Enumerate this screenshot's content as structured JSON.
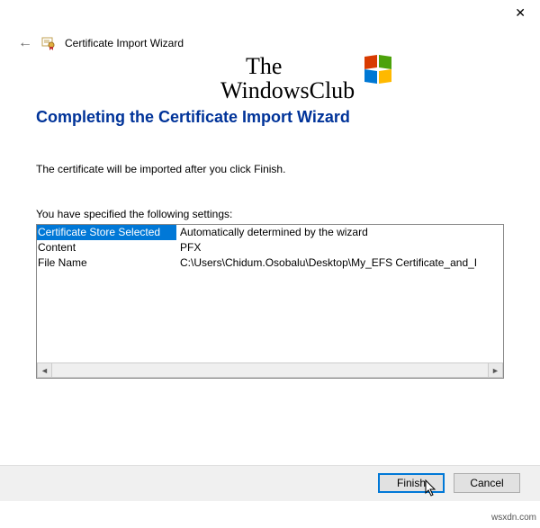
{
  "window": {
    "wizard_title": "Certificate Import Wizard"
  },
  "watermark": {
    "line1": "The",
    "line2": "WindowsClub"
  },
  "main": {
    "heading": "Completing the Certificate Import Wizard",
    "instruction": "The certificate will be imported after you click Finish.",
    "settings_label": "You have specified the following settings:",
    "rows": [
      {
        "label": "Certificate Store Selected",
        "value": "Automatically determined by the wizard"
      },
      {
        "label": "Content",
        "value": "PFX"
      },
      {
        "label": "File Name",
        "value": "C:\\Users\\Chidum.Osobalu\\Desktop\\My_EFS Certificate_and_I"
      }
    ]
  },
  "buttons": {
    "finish": "Finish",
    "cancel": "Cancel"
  },
  "source": "wsxdn.com"
}
